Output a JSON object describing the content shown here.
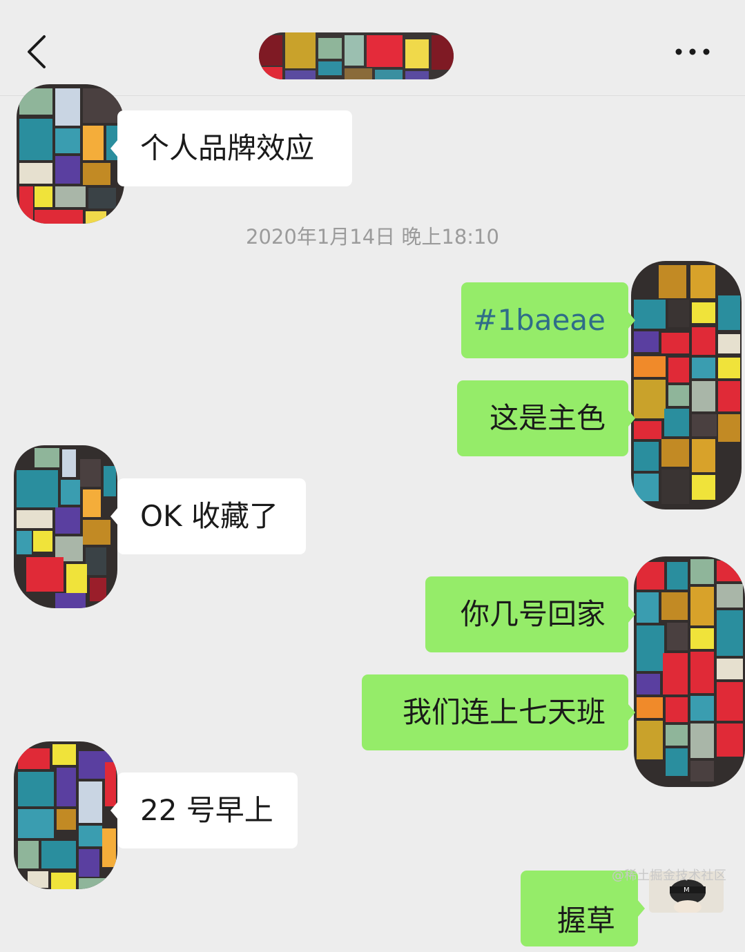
{
  "header": {
    "back_icon": "chevron-left-icon",
    "more_icon": "ellipsis-icon",
    "title_redacted": true
  },
  "colors": {
    "background": "#ededed",
    "incoming_bubble": "#ffffff",
    "outgoing_bubble": "#95ec69",
    "timestamp_text": "#9b9b9b",
    "color_code_text": "#2f6d88"
  },
  "timestamp": "2020年1月14日 晚上18:10",
  "messages": [
    {
      "sender": "other",
      "text": "个人品牌效应"
    },
    {
      "sender": "me",
      "text": "#1baeae"
    },
    {
      "sender": "me",
      "text": "这是主色"
    },
    {
      "sender": "other",
      "text": "OK 收藏了"
    },
    {
      "sender": "me",
      "text": "你几号回家"
    },
    {
      "sender": "me",
      "text": "我们连上七天班"
    },
    {
      "sender": "other",
      "text": "22 号早上"
    },
    {
      "sender": "me",
      "text": "握草"
    }
  ],
  "watermark": "@稀土掘金技术社区"
}
